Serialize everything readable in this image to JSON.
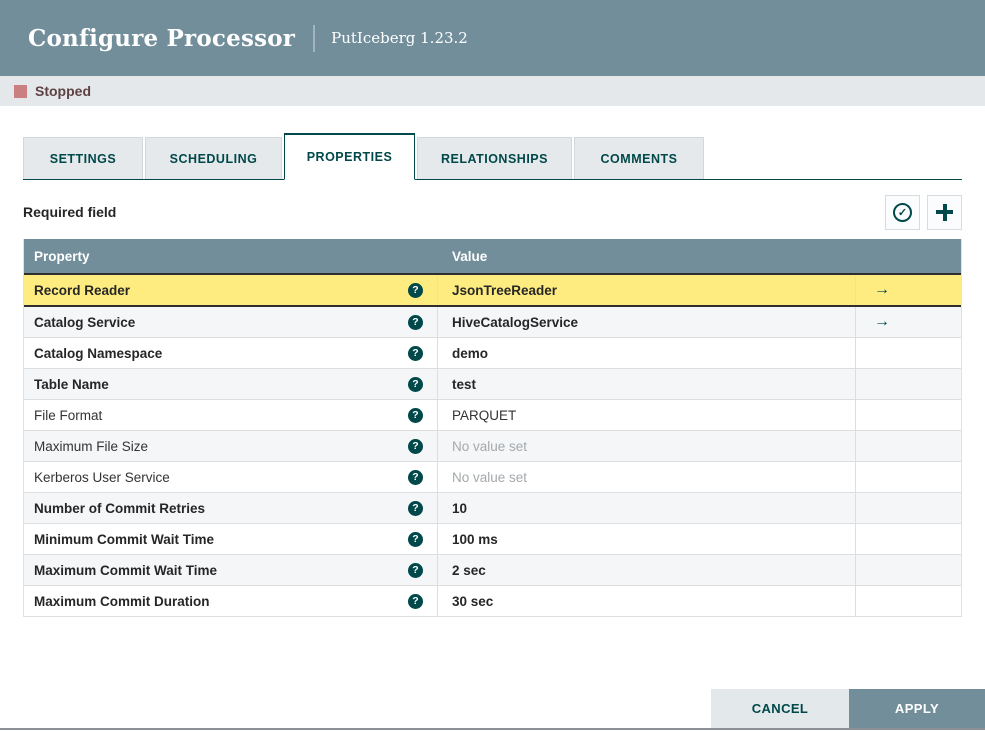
{
  "dialog": {
    "title": "Configure Processor",
    "subtitle": "PutIceberg 1.23.2"
  },
  "status": {
    "label": "Stopped"
  },
  "tabs": [
    {
      "label": "SETTINGS",
      "active": false
    },
    {
      "label": "SCHEDULING",
      "active": false
    },
    {
      "label": "PROPERTIES",
      "active": true
    },
    {
      "label": "RELATIONSHIPS",
      "active": false
    },
    {
      "label": "COMMENTS",
      "active": false
    }
  ],
  "toolbar": {
    "required_label": "Required field"
  },
  "table": {
    "columns": [
      "Property",
      "Value"
    ],
    "rows": [
      {
        "property": "Record Reader",
        "value": "JsonTreeReader",
        "required": true,
        "selected": true,
        "goto": true,
        "empty": false
      },
      {
        "property": "Catalog Service",
        "value": "HiveCatalogService",
        "required": true,
        "selected": false,
        "goto": true,
        "empty": false
      },
      {
        "property": "Catalog Namespace",
        "value": "demo",
        "required": true,
        "selected": false,
        "goto": false,
        "empty": false
      },
      {
        "property": "Table Name",
        "value": "test",
        "required": true,
        "selected": false,
        "goto": false,
        "empty": false
      },
      {
        "property": "File Format",
        "value": "PARQUET",
        "required": false,
        "selected": false,
        "goto": false,
        "empty": false
      },
      {
        "property": "Maximum File Size",
        "value": "No value set",
        "required": false,
        "selected": false,
        "goto": false,
        "empty": true
      },
      {
        "property": "Kerberos User Service",
        "value": "No value set",
        "required": false,
        "selected": false,
        "goto": false,
        "empty": true
      },
      {
        "property": "Number of Commit Retries",
        "value": "10",
        "required": true,
        "selected": false,
        "goto": false,
        "empty": false
      },
      {
        "property": "Minimum Commit Wait Time",
        "value": "100 ms",
        "required": true,
        "selected": false,
        "goto": false,
        "empty": false
      },
      {
        "property": "Maximum Commit Wait Time",
        "value": "2 sec",
        "required": true,
        "selected": false,
        "goto": false,
        "empty": false
      },
      {
        "property": "Maximum Commit Duration",
        "value": "30 sec",
        "required": true,
        "selected": false,
        "goto": false,
        "empty": false
      }
    ]
  },
  "footer": {
    "cancel_label": "CANCEL",
    "apply_label": "APPLY"
  },
  "colors": {
    "header_bg": "#728e9b",
    "accent_teal": "#004849",
    "selected_row_bg": "#ffec80",
    "stopped_red": "#ca7f80",
    "status_bar_bg": "#e4e8ea"
  }
}
